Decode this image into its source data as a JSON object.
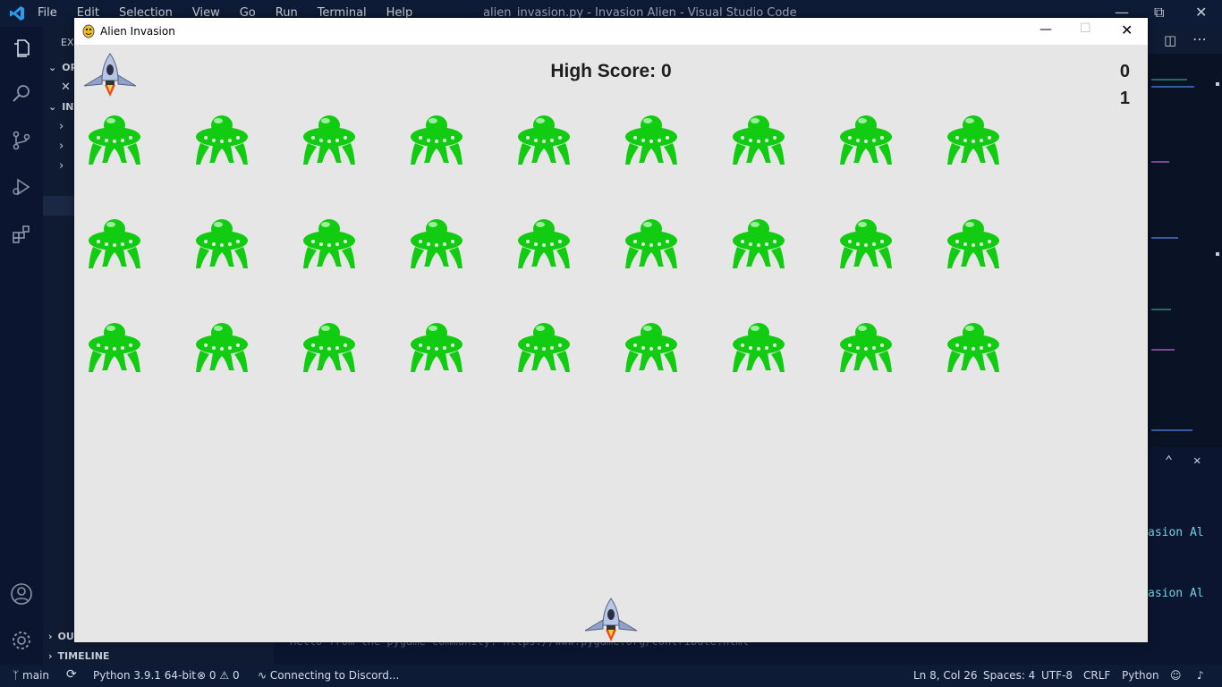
{
  "vscode": {
    "menu": [
      "File",
      "Edit",
      "Selection",
      "View",
      "Go",
      "Run",
      "Terminal",
      "Help"
    ],
    "title": "alien_invasion.py - Invasion Alien - Visual Studio Code",
    "sidebar": {
      "explorer_label": "EXI",
      "open_editors": "OP",
      "project": "INV",
      "outline": "OU",
      "timeline": "TIMELINE"
    },
    "terminal_line_1": "asion Al",
    "terminal_line_2": "asion Al",
    "bottom_text": "Hello from the pygame community. https://www.pygame.org/contribute.html"
  },
  "statusbar": {
    "branch": "main",
    "python": "Python 3.9.1 64-bit",
    "errors": "0",
    "warnings": "0",
    "discord": "Connecting to Discord...",
    "position": "Ln 8, Col 26",
    "spaces": "Spaces: 4",
    "encoding": "UTF-8",
    "eol": "CRLF",
    "language": "Python"
  },
  "game": {
    "window_title": "Alien Invasion",
    "high_score": "High Score: 0",
    "score": "0",
    "level": "1",
    "alien_rows": 3,
    "alien_cols": 9,
    "alien_color": "#11cc11",
    "background": "#e6e6e6"
  }
}
